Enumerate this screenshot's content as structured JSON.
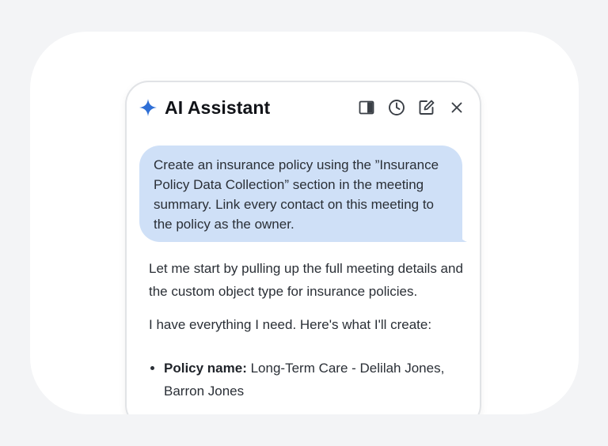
{
  "header": {
    "title": "AI Assistant",
    "icons": [
      "sparkle-icon",
      "sidebar-toggle-icon",
      "history-icon",
      "new-chat-icon",
      "close-icon"
    ],
    "accent_color": "#2f6fd6"
  },
  "messages": {
    "user": {
      "text": "Create an insurance policy using the ”Insurance Policy Data Collection” section in the meeting summary. Link every contact on this meeting to the policy as the owner.",
      "bubble_color": "#cfe0f7"
    },
    "assistant": {
      "paragraph_1": "Let me start by pulling up the full meeting details and the custom object type for insurance policies.",
      "paragraph_2": "I have everything I need. Here's what I'll create:",
      "list": [
        {
          "label": "Policy name:",
          "value": " Long-Term Care - Delilah Jones, Barron Jones"
        }
      ]
    }
  }
}
